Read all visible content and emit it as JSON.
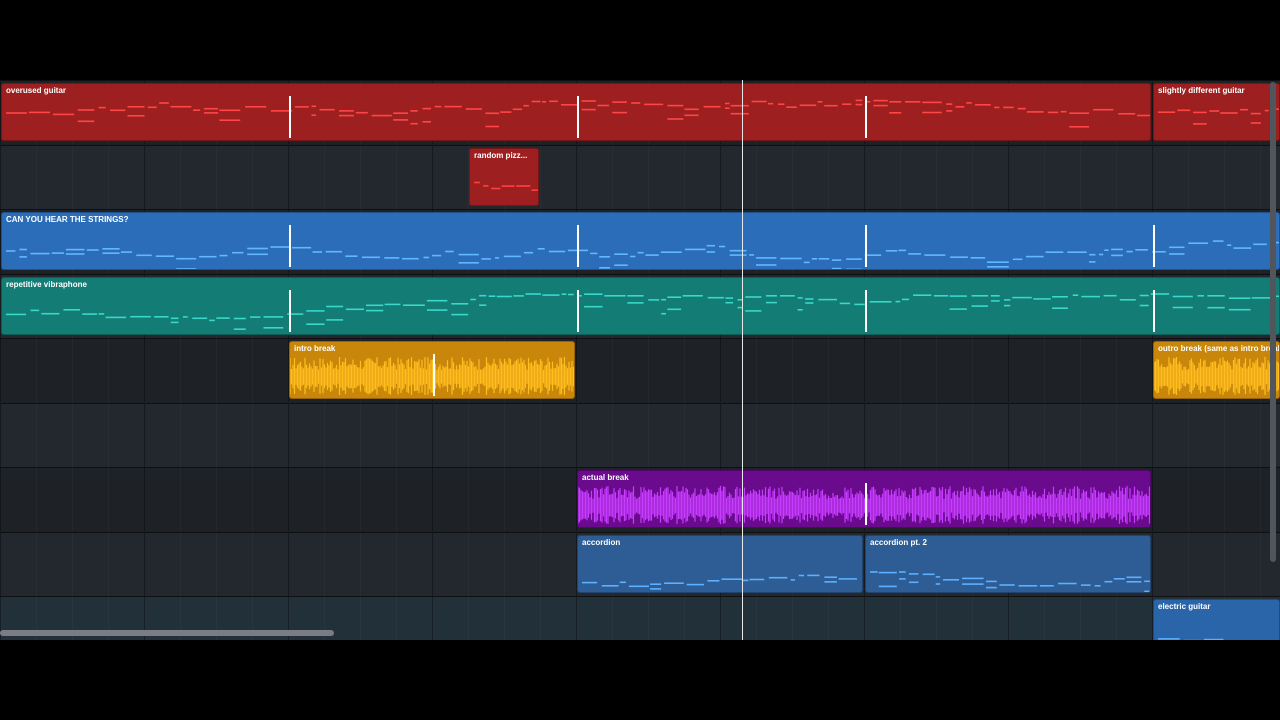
{
  "clips": [
    {
      "name": "overused guitar",
      "lane": 0,
      "start": 0,
      "end": 8,
      "kind": "notes",
      "color": "#9e1f1f",
      "note_color": "#ff4646",
      "seed": 3,
      "loops": [
        2,
        4,
        6
      ]
    },
    {
      "name": "slightly different guitar",
      "lane": 0,
      "start": 8,
      "end": 8.9,
      "kind": "notes",
      "color": "#9e1f1f",
      "note_color": "#ff4646",
      "seed": 4,
      "loops": []
    },
    {
      "name": "random pizz...",
      "lane": 1,
      "start": 3.25,
      "end": 3.75,
      "kind": "notes",
      "color": "#9e1f1f",
      "note_color": "#ff4040",
      "seed": 7,
      "loops": []
    },
    {
      "name": "CAN YOU HEAR THE STRINGS?",
      "lane": 2,
      "start": 0,
      "end": 8.9,
      "kind": "notes",
      "color": "#2b6db8",
      "note_color": "#61b8ff",
      "seed": 11,
      "loops": [
        2,
        4,
        6,
        8
      ]
    },
    {
      "name": "repetitive vibraphone",
      "lane": 3,
      "start": 0,
      "end": 8.9,
      "kind": "notes",
      "color": "#137c75",
      "note_color": "#39d8c9",
      "seed": 13,
      "loops": [
        2,
        4,
        6,
        8
      ]
    },
    {
      "name": "intro break",
      "lane": 4,
      "start": 2,
      "end": 4,
      "kind": "audio",
      "color": "#c8860a",
      "note_color": "#ffbe1e",
      "seed": 17,
      "loops": [
        3
      ]
    },
    {
      "name": "outro break (same as intro break)",
      "lane": 4,
      "start": 8,
      "end": 8.9,
      "kind": "audio",
      "color": "#c8860a",
      "note_color": "#ffbe1e",
      "seed": 19,
      "loops": []
    },
    {
      "name": "actual break",
      "lane": 6,
      "start": 4,
      "end": 8,
      "kind": "audio",
      "color": "#6a0b8e",
      "note_color": "#c73cff",
      "seed": 23,
      "loops": [
        6
      ]
    },
    {
      "name": "accordion",
      "lane": 7,
      "start": 4,
      "end": 6,
      "kind": "notes",
      "color": "#2d5d94",
      "note_color": "#5cb0ff",
      "seed": 29,
      "loops": []
    },
    {
      "name": "accordion pt. 2",
      "lane": 7,
      "start": 6,
      "end": 8,
      "kind": "notes",
      "color": "#2d5d94",
      "note_color": "#5cb0ff",
      "seed": 31,
      "loops": []
    },
    {
      "name": "electric guitar",
      "lane": 8,
      "start": 8,
      "end": 8.9,
      "kind": "notes",
      "color": "#2a65aa",
      "note_color": "#5cb0ff",
      "seed": 37,
      "loops": []
    }
  ],
  "timeline": {
    "bars_visible": 8.9,
    "playhead_bar": 5.15,
    "lane_count": 9
  }
}
